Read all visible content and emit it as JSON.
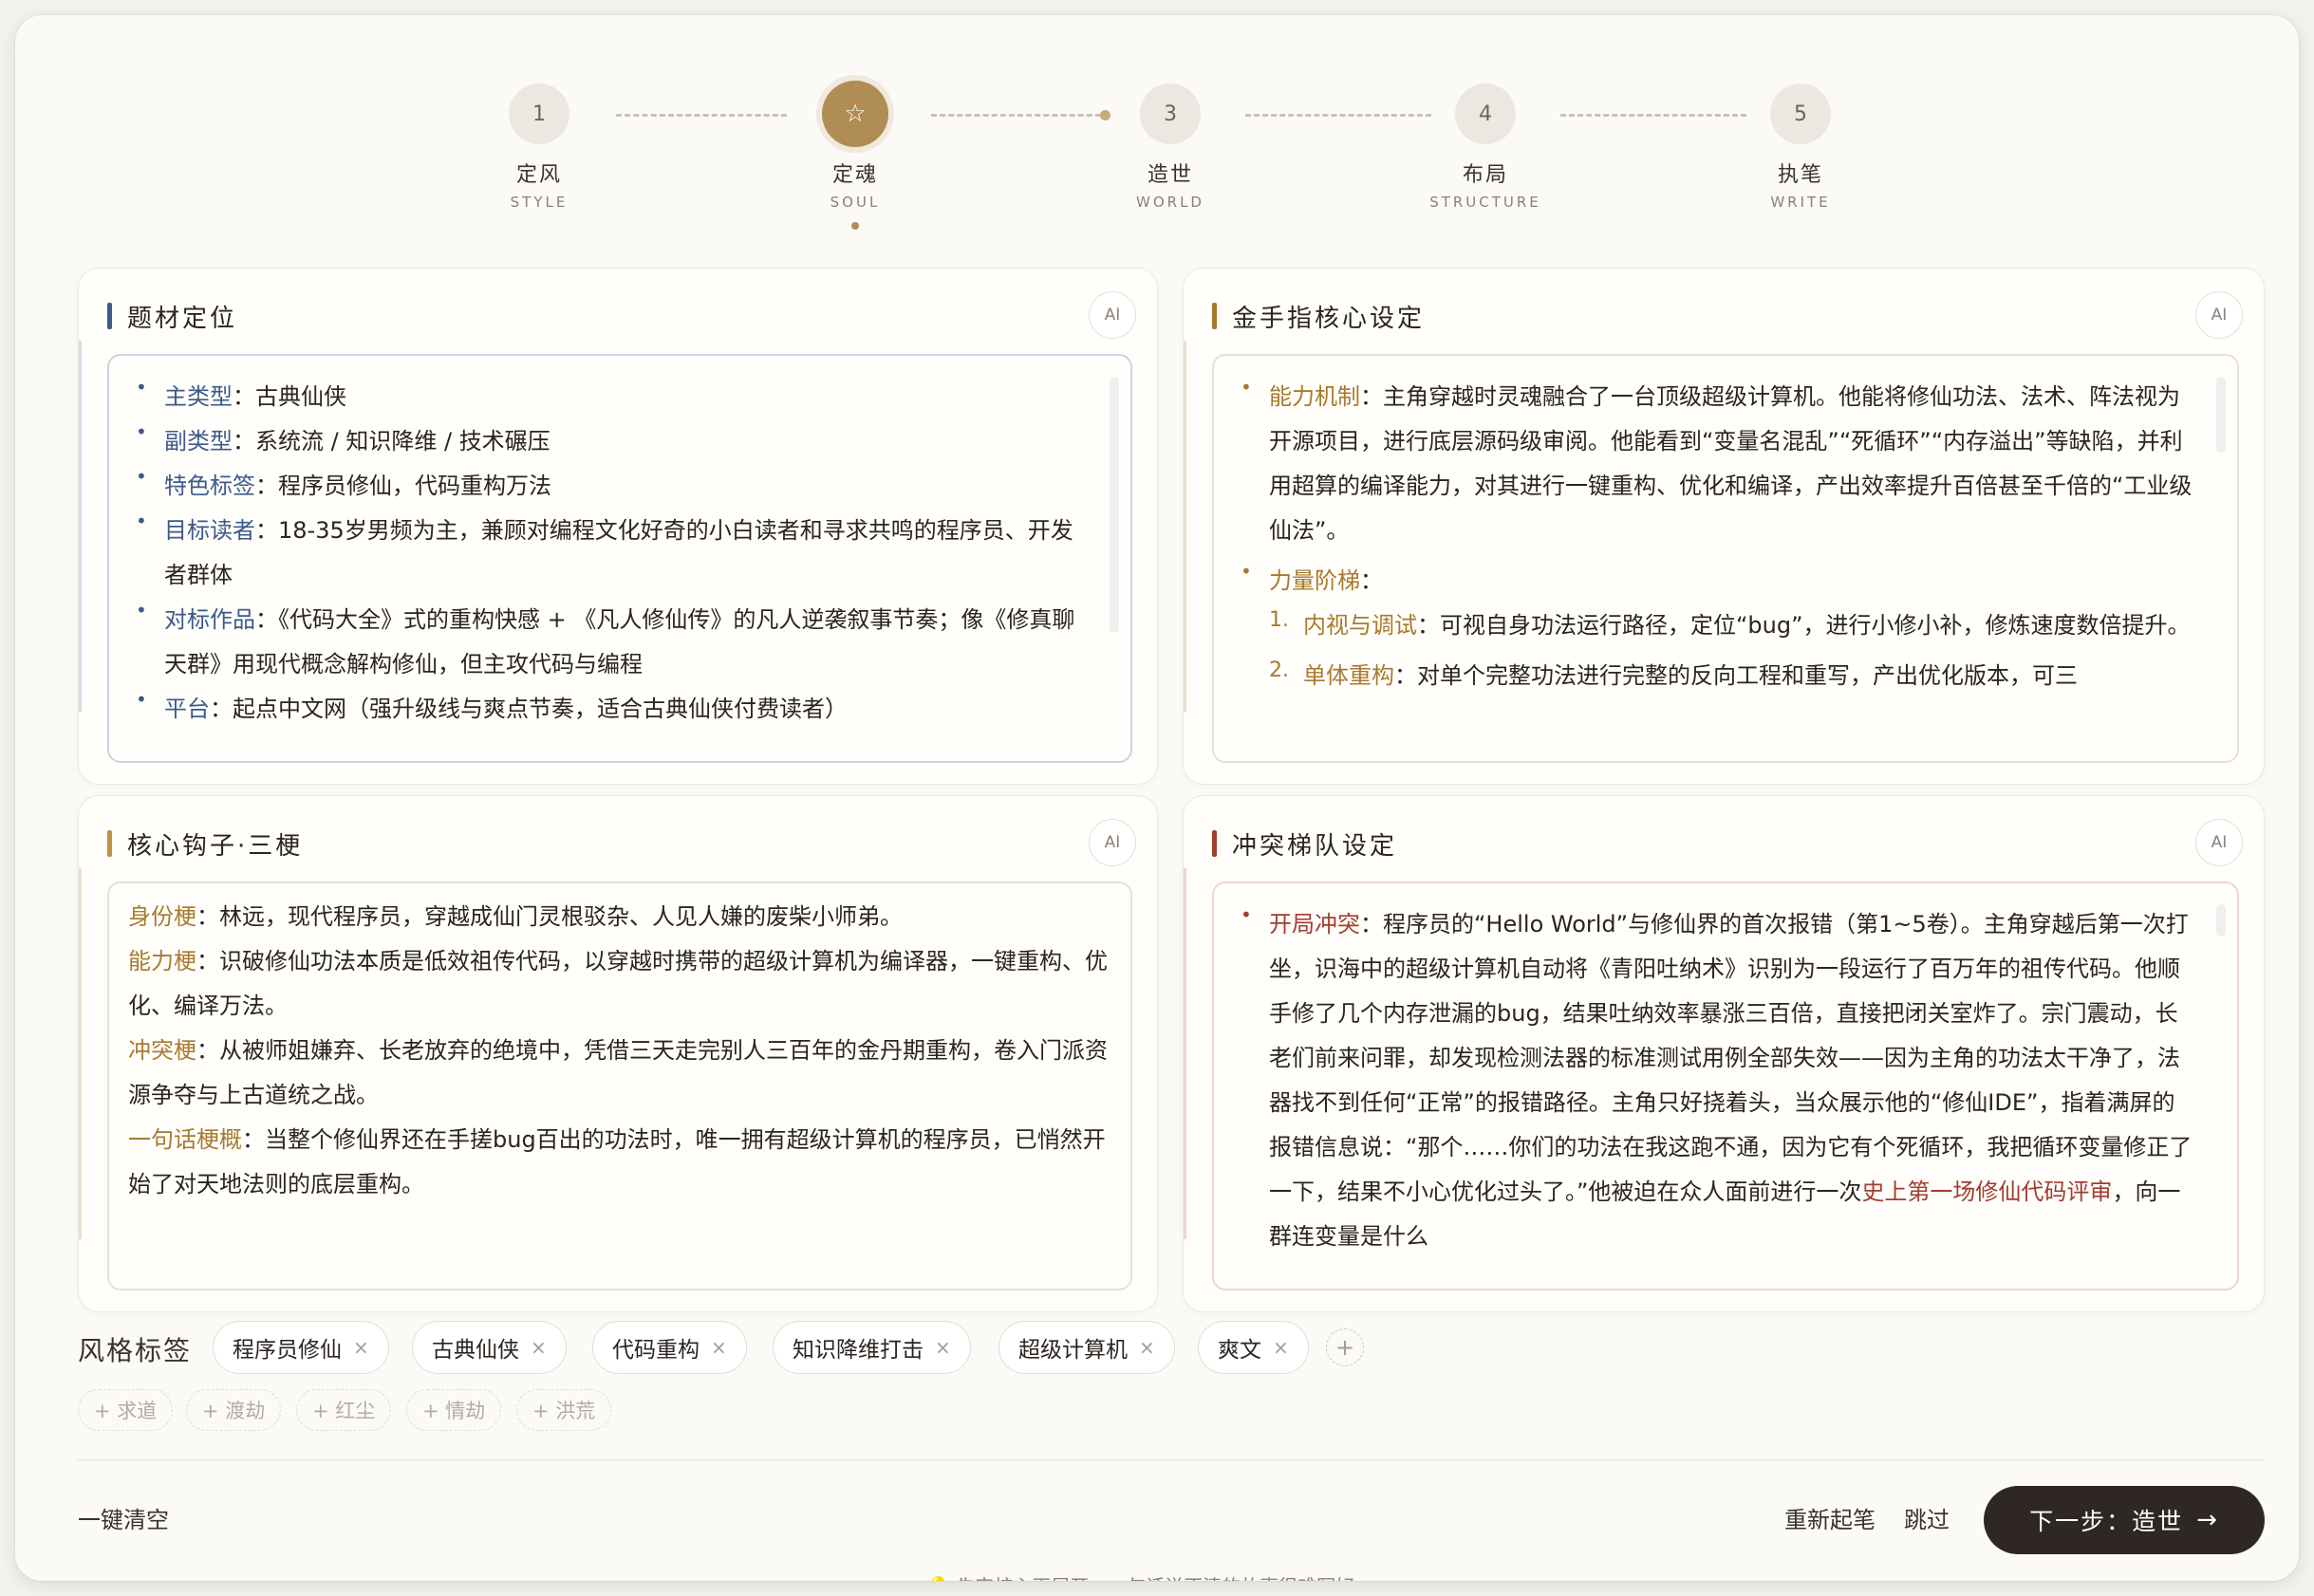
{
  "steps": [
    {
      "mark": "1",
      "cn": "定风",
      "en": "STYLE"
    },
    {
      "mark": "☆",
      "cn": "定魂",
      "en": "SOUL"
    },
    {
      "mark": "3",
      "cn": "造世",
      "en": "WORLD"
    },
    {
      "mark": "4",
      "cn": "布局",
      "en": "STRUCTURE"
    },
    {
      "mark": "5",
      "cn": "执笔",
      "en": "WRITE"
    }
  ],
  "active_step": 2,
  "cards": {
    "genre": {
      "title": "题材定位",
      "ai": "AI",
      "items": [
        {
          "key": "主类型",
          "sep": "：",
          "text": "古典仙侠"
        },
        {
          "key": "副类型",
          "sep": "：",
          "text": "系统流 / 知识降维 / 技术碾压"
        },
        {
          "key": "特色标签",
          "sep": "：",
          "text": "程序员修仙，代码重构万法"
        },
        {
          "key": "目标读者",
          "sep": "：",
          "text": "18-35岁男频为主，兼顾对编程文化好奇的小白读者和寻求共鸣的程序员、开发者群体"
        },
        {
          "key": "对标作品",
          "sep": "：",
          "text": "《代码大全》式的重构快感 + 《凡人修仙传》的凡人逆袭叙事节奏；像《修真聊天群》用现代概念解构修仙，但主攻代码与编程"
        },
        {
          "key": "平台",
          "sep": "：",
          "text": "起点中文网（强升级线与爽点节奏，适合古典仙侠付费读者）"
        }
      ]
    },
    "cheat": {
      "title": "金手指核心设定",
      "ai": "AI",
      "mechanism_key": "能力机制",
      "mechanism_sep": "：",
      "mechanism_text": "主角穿越时灵魂融合了一台顶级超级计算机。他能将修仙功法、法术、阵法视为开源项目，进行底层源码级审阅。他能看到“变量名混乱”“死循环”“内存溢出”等缺陷，并利用超算的编译能力，对其进行一键重构、优化和编译，产出效率提升百倍甚至千倍的“工业级仙法”。",
      "ladder_key": "力量阶梯",
      "ladder_sep": "：",
      "ladder": [
        {
          "n": "1.",
          "key": "内视与调试",
          "sep": "：",
          "text": "可视自身功法运行路径，定位“bug”，进行小修小补，修炼速度数倍提升。"
        },
        {
          "n": "2.",
          "key": "单体重构",
          "sep": "：",
          "text": "对单个完整功法进行完整的反向工程和重写，产出优化版本，可三"
        }
      ]
    },
    "hooks": {
      "title": "核心钩子·三梗",
      "ai": "AI",
      "items": [
        {
          "key": "身份梗",
          "sep": "：",
          "text": "林远，现代程序员，穿越成仙门灵根驳杂、人见人嫌的废柴小师弟。"
        },
        {
          "key": "能力梗",
          "sep": "：",
          "text": "识破修仙功法本质是低效祖传代码，以穿越时携带的超级计算机为编译器，一键重构、优化、编译万法。"
        },
        {
          "key": "冲突梗",
          "sep": "：",
          "text": "从被师姐嫌弃、长老放弃的绝境中，凭借三天走完别人三百年的金丹期重构，卷入门派资源争夺与上古道统之战。"
        },
        {
          "key": "一句话梗概",
          "sep": "：",
          "text": "当整个修仙界还在手搓bug百出的功法时，唯一拥有超级计算机的程序员，已悄然开始了对天地法则的底层重构。"
        }
      ]
    },
    "conflict": {
      "title": "冲突梯队设定",
      "ai": "AI",
      "key": "开局冲突",
      "sep": "：",
      "text": "程序员的“Hello World”与修仙界的首次报错（第1~5卷）。主角穿越后第一次打坐，识海中的超级计算机自动将《青阳吐纳术》识别为一段运行了百万年的祖传代码。他顺手修了几个内存泄漏的bug，结果吐纳效率暴涨三百倍，直接把闭关室炸了。宗门震动，长老们前来问罪，却发现检测法器的标准测试用例全部失效——因为主角的功法太干净了，法器找不到任何“正常”的报错路径。主角只好挠着头，当众展示他的“修仙IDE”，指着满屏的报错信息说：“那个……你们的功法在我这跑不通，因为它有个死循环，我把循环变量修正了一下，结果不小心优化过头了。”他被迫在众人面前进行一次",
      "highlight": "史上第一场修仙代码评审",
      "tail": "，向一群连变量是什么"
    }
  },
  "tags_label": "风格标签",
  "tags": [
    "程序员修仙",
    "古典仙侠",
    "代码重构",
    "知识降维打击",
    "超级计算机",
    "爽文"
  ],
  "tag_remove": "×",
  "tag_add": "+",
  "suggestions": [
    "+ 求道",
    "+ 渡劫",
    "+ 红尘",
    "+ 情劫",
    "+ 洪荒"
  ],
  "footer": {
    "clear": "一键清空",
    "restart": "重新起笔",
    "skip": "跳过",
    "next": "下一步：造世",
    "next_arrow": "→",
    "hint": "💡 先定核心再展开，一句话说不清的故事很难写好"
  },
  "colors": {
    "accent_gold": "#b08d55",
    "key_blue": "#3d5a8a",
    "key_gold": "#a87a2e",
    "key_red": "#a23d2e",
    "dark_button": "#2f2724"
  }
}
